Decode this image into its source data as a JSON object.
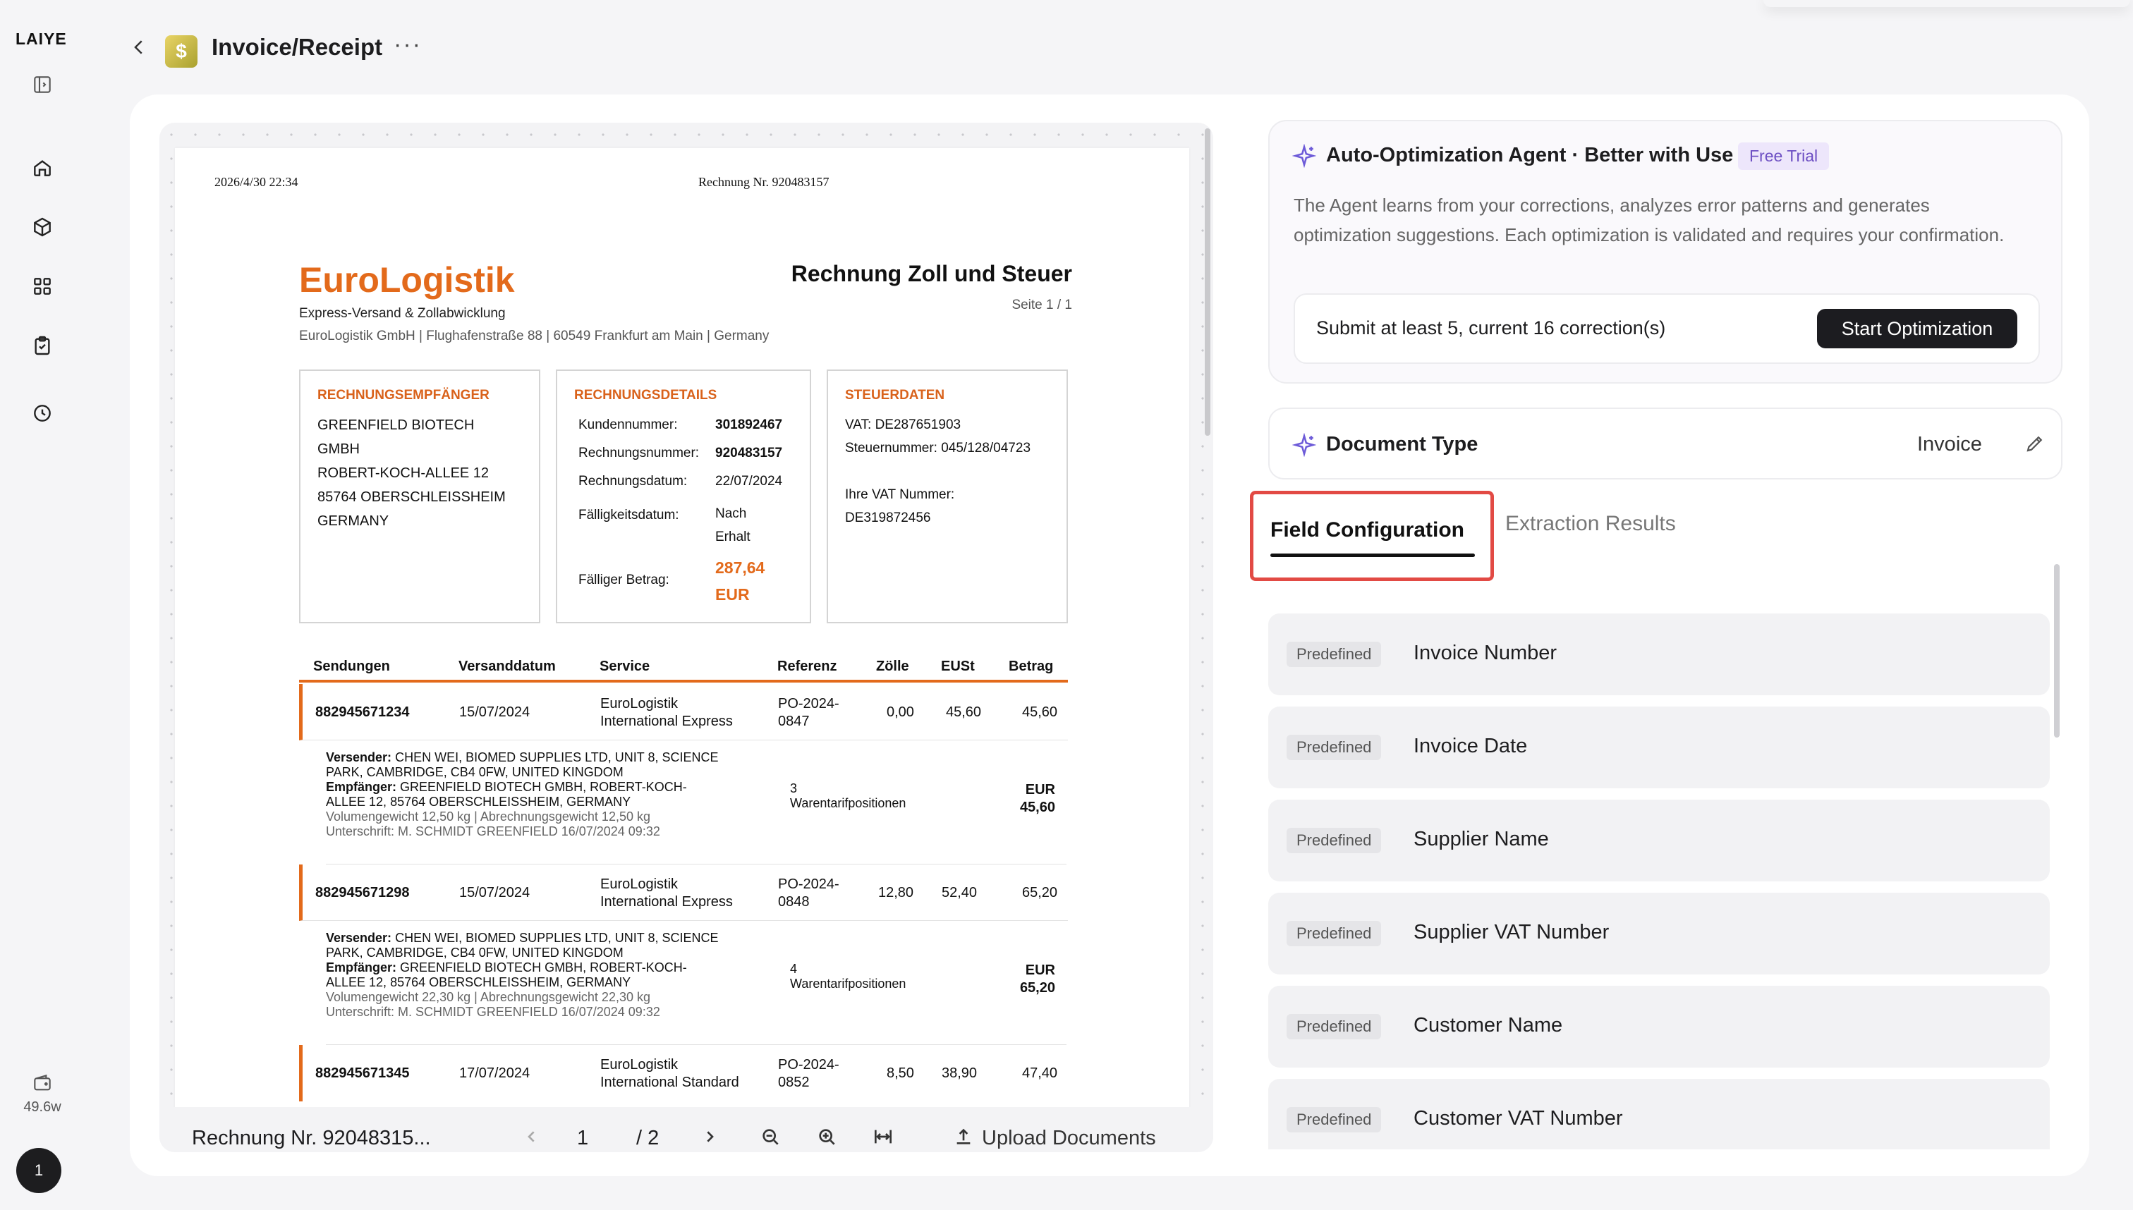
{
  "app": {
    "logo": "LAIYE",
    "credits": "49.6w",
    "user_initial": "1",
    "accent": "#e36a1b",
    "highlight": "#e24a44"
  },
  "header": {
    "doc_icon": "$",
    "title": "Invoice/Receipt",
    "more": "···"
  },
  "document": {
    "printed_at": "2026/4/30 22:34",
    "header_ref": "Rechnung Nr. 920483157",
    "company": "EuroLogistik",
    "tagline": "Express-Versand & Zollabwicklung",
    "company_address": "EuroLogistik GmbH | Flughafenstraße 88 | 60549 Frankfurt am Main | Germany",
    "doc_title": "Rechnung Zoll und Steuer",
    "page": "Seite 1 / 1",
    "recipient": {
      "heading": "RECHNUNGSEMPFÄNGER",
      "lines": [
        "GREENFIELD BIOTECH",
        "GMBH",
        "ROBERT-KOCH-ALLEE 12",
        "85764 OBERSCHLEISSHEIM",
        "GERMANY"
      ]
    },
    "details": {
      "heading": "RECHNUNGSDETAILS",
      "customer_no_label": "Kundennummer:",
      "customer_no": "301892467",
      "invoice_no_label": "Rechnungsnummer:",
      "invoice_no": "920483157",
      "invoice_date_label": "Rechnungsdatum:",
      "invoice_date": "22/07/2024",
      "due_label": "Fälligkeitsdatum:",
      "due_1": "Nach",
      "due_2": "Erhalt",
      "amount_label": "Fälliger Betrag:",
      "amount_1": "287,64",
      "amount_2": "EUR"
    },
    "tax": {
      "heading": "STEUERDATEN",
      "vat": "VAT: DE287651903",
      "tax_no": "Steuernummer: 045/128/04723",
      "vat_label": "Ihre VAT Nummer:",
      "vat_customer": "DE319872456"
    },
    "columns": [
      "Sendungen",
      "Versanddatum",
      "Service",
      "Referenz",
      "Zölle",
      "EUSt",
      "Betrag"
    ],
    "rows": [
      {
        "id": "882945671234",
        "date": "15/07/2024",
        "svc1": "EuroLogistik",
        "svc2": "International Express",
        "ref1": "PO-2024-",
        "ref2": "0847",
        "duty": "0,00",
        "vat": "45,60",
        "total": "45,60",
        "sender_label": "Versender:",
        "sender_1": "CHEN WEI, BIOMED SUPPLIES LTD, UNIT 8, SCIENCE",
        "sender_2": "PARK, CAMBRIDGE, CB4 0FW, UNITED KINGDOM",
        "recv_label": "Empfänger:",
        "recv_1": "GREENFIELD BIOTECH GMBH, ROBERT-KOCH-",
        "recv_2": "ALLEE 12, 85764 OBERSCHLEISSHEIM, GERMANY",
        "weight": "Volumengewicht 12,50 kg | Abrechnungsgewicht 12,50 kg",
        "sign": "Unterschrift: M. SCHMIDT GREENFIELD 16/07/2024 09:32",
        "positions_1": "3",
        "positions_2": "Warentarifpositionen",
        "cur": "EUR",
        "amt": "45,60"
      },
      {
        "id": "882945671298",
        "date": "15/07/2024",
        "svc1": "EuroLogistik",
        "svc2": "International Express",
        "ref1": "PO-2024-",
        "ref2": "0848",
        "duty": "12,80",
        "vat": "52,40",
        "total": "65,20",
        "sender_label": "Versender:",
        "sender_1": "CHEN WEI, BIOMED SUPPLIES LTD, UNIT 8, SCIENCE",
        "sender_2": "PARK, CAMBRIDGE, CB4 0FW, UNITED KINGDOM",
        "recv_label": "Empfänger:",
        "recv_1": "GREENFIELD BIOTECH GMBH, ROBERT-KOCH-",
        "recv_2": "ALLEE 12, 85764 OBERSCHLEISSHEIM, GERMANY",
        "weight": "Volumengewicht 22,30 kg | Abrechnungsgewicht 22,30 kg",
        "sign": "Unterschrift: M. SCHMIDT GREENFIELD 16/07/2024 09:32",
        "positions_1": "4",
        "positions_2": "Warentarifpositionen",
        "cur": "EUR",
        "amt": "65,20"
      },
      {
        "id": "882945671345",
        "date": "17/07/2024",
        "svc1": "EuroLogistik",
        "svc2": "International Standard",
        "ref1": "PO-2024-",
        "ref2": "0852",
        "duty": "8,50",
        "vat": "38,90",
        "total": "47,40"
      }
    ]
  },
  "viewer": {
    "file_name": "Rechnung Nr. 92048315...",
    "page_current": "1",
    "page_total": "/  2",
    "upload_label": "Upload Documents"
  },
  "agent": {
    "title": "Auto-Optimization Agent · Better with Use",
    "badge": "Free Trial",
    "description": "The Agent learns from your corrections, analyzes error patterns and generates optimization suggestions. Each optimization is validated and requires your confirmation.",
    "note": "Submit at least 5, current 16 correction(s)",
    "button": "Start Optimization"
  },
  "doc_type": {
    "label": "Document Type",
    "value": "Invoice"
  },
  "tabs": [
    {
      "label": "Field Configuration",
      "active": true
    },
    {
      "label": "Extraction Results",
      "active": false
    }
  ],
  "fields": [
    {
      "tag": "Predefined",
      "name": "Invoice Number"
    },
    {
      "tag": "Predefined",
      "name": "Invoice Date"
    },
    {
      "tag": "Predefined",
      "name": "Supplier Name"
    },
    {
      "tag": "Predefined",
      "name": "Supplier VAT Number"
    },
    {
      "tag": "Predefined",
      "name": "Customer Name"
    },
    {
      "tag": "Predefined",
      "name": "Customer VAT Number"
    }
  ]
}
